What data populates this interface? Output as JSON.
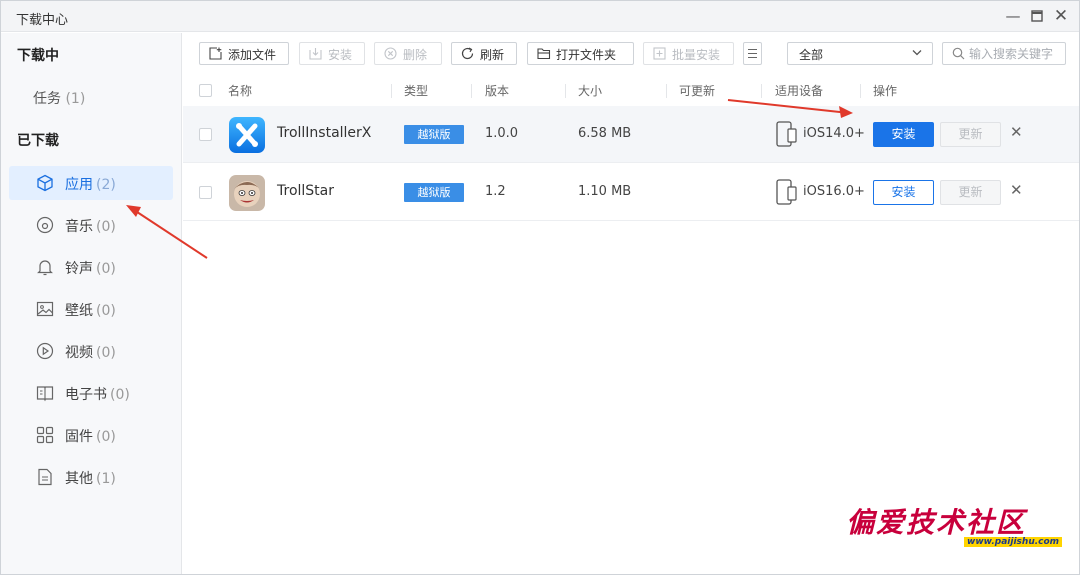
{
  "window": {
    "title": "下载中心"
  },
  "sidebar": {
    "downloading_header": "下载中心",
    "downloading_label": "下载中",
    "task": {
      "label": "任务",
      "count": "(1)"
    },
    "downloaded_label": "已下载",
    "items": [
      {
        "label": "应用",
        "count": "(2)",
        "icon": "cube-icon",
        "active": true
      },
      {
        "label": "音乐",
        "count": "(0)",
        "icon": "music-disc-icon"
      },
      {
        "label": "铃声",
        "count": "(0)",
        "icon": "bell-icon"
      },
      {
        "label": "壁纸",
        "count": "(0)",
        "icon": "image-icon"
      },
      {
        "label": "视频",
        "count": "(0)",
        "icon": "play-circle-icon"
      },
      {
        "label": "电子书",
        "count": "(0)",
        "icon": "book-icon"
      },
      {
        "label": "固件",
        "count": "(0)",
        "icon": "grid-icon"
      },
      {
        "label": "其他",
        "count": "(1)",
        "icon": "file-icon"
      }
    ]
  },
  "toolbar": {
    "add_file": "添加文件",
    "install": "安装",
    "delete": "删除",
    "refresh": "刷新",
    "open_folder": "打开文件夹",
    "batch_install": "批量安装",
    "filter_value": "全部",
    "search_placeholder": "输入搜索关键字"
  },
  "table": {
    "headers": {
      "name": "名称",
      "type": "类型",
      "version": "版本",
      "size": "大小",
      "updatable": "可更新",
      "device": "适用设备",
      "action": "操作"
    },
    "rows": [
      {
        "name": "TrollInstallerX",
        "type": "越狱版",
        "version": "1.0.0",
        "size": "6.58 MB",
        "device": "iOS14.0+",
        "install": "安装",
        "update": "更新"
      },
      {
        "name": "TrollStar",
        "type": "越狱版",
        "version": "1.2",
        "size": "1.10 MB",
        "device": "iOS16.0+",
        "install": "安装",
        "update": "更新"
      }
    ]
  },
  "watermark": {
    "title": "偏爱技术社区",
    "url": "www.paijishu.com"
  },
  "colors": {
    "accent": "#1a74e8",
    "badge": "#3a8ee6",
    "watermark": "#c8003c",
    "arrow": "#e0392b"
  }
}
